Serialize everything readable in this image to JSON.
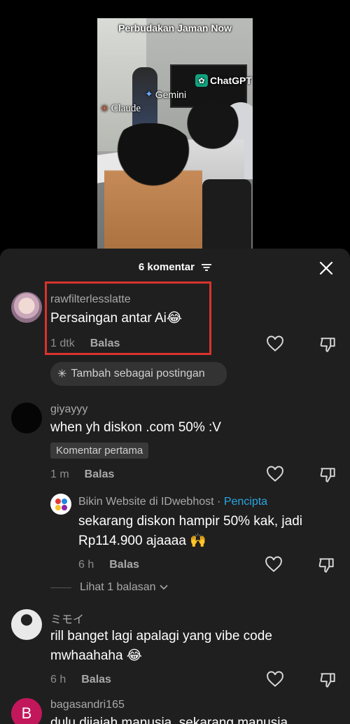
{
  "video": {
    "caption": "Perbudakan Jaman Now",
    "labels": {
      "claude": "Claude",
      "gemini": "Gemini",
      "chatgpt": "ChatGPT"
    }
  },
  "header": {
    "count_label": "6 komentar"
  },
  "comments": [
    {
      "username": "rawfilterlesslatte",
      "text": "Persaingan antar Ai😂",
      "time": "1 dtk",
      "reply_label": "Balas",
      "add_post_label": "Tambah sebagai postingan"
    },
    {
      "username": "giyayyy",
      "text": "when yh diskon .com 50% :V",
      "tag": "Komentar pertama",
      "time": "1 m",
      "reply_label": "Balas",
      "reply": {
        "username": "Bikin Website di IDwebhost",
        "separator": "·",
        "creator_label": "Pencipta",
        "text_line1": "sekarang diskon hampir 50% kak, jadi",
        "text_line2": "Rp114.900 ajaaaa 🙌",
        "time": "6 h",
        "reply_label": "Balas"
      },
      "view_replies": "Lihat 1 balasan"
    },
    {
      "username": "ミモイ",
      "text_line1": "rill banget lagi apalagi yang vibe code",
      "text_line2": "mwhaahaha 😂",
      "time": "6 h",
      "reply_label": "Balas"
    },
    {
      "username": "bagasandri165",
      "avatar_letter": "B",
      "text": "dulu dijajah manusia, sekarang manusia"
    }
  ],
  "colors": {
    "panel": "#1f1f1f",
    "highlight": "#d9332c",
    "creator": "#29a6e0",
    "avatar_b": "#c2185b"
  }
}
